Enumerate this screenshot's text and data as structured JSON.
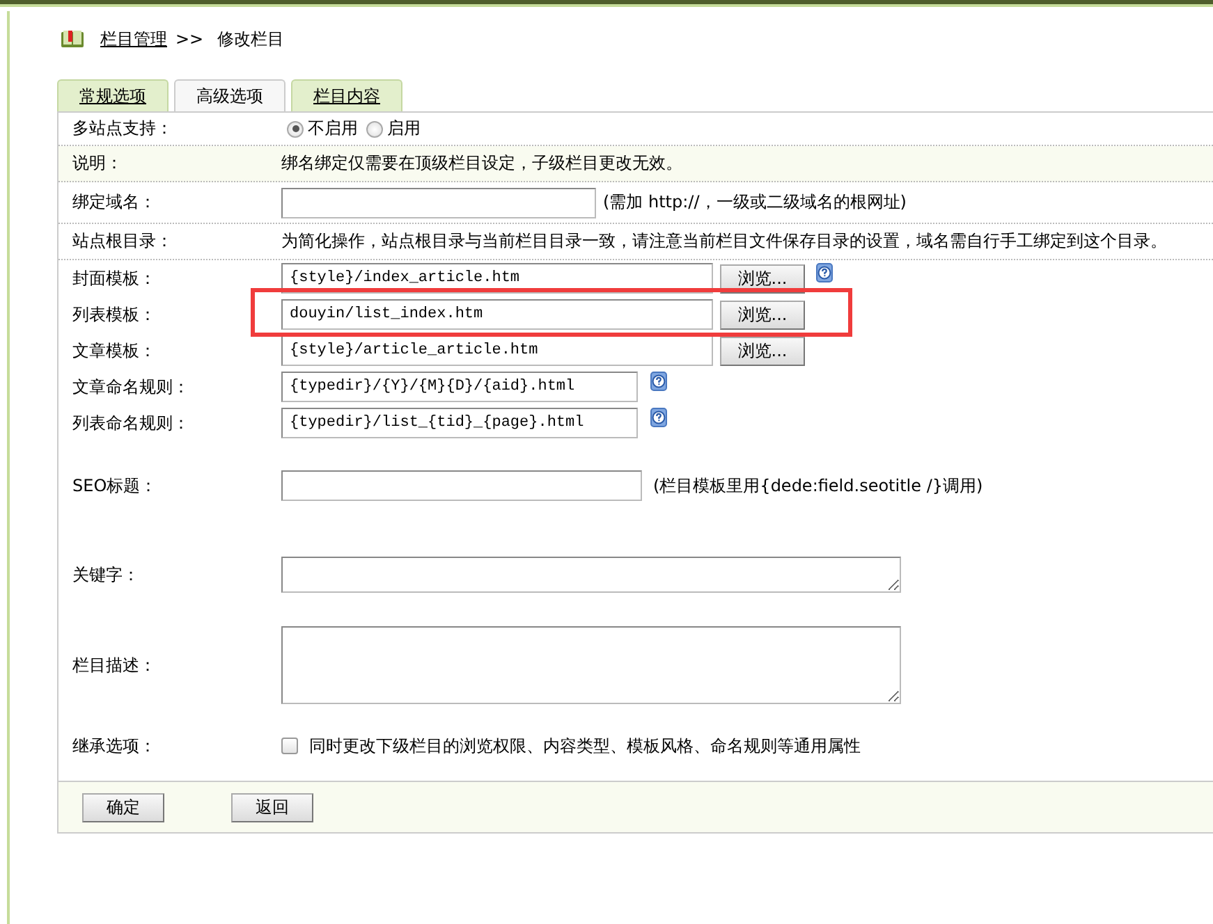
{
  "breadcrumb": {
    "link": "栏目管理",
    "separator": ">>",
    "current": "修改栏目"
  },
  "tabs": [
    {
      "label": "常规选项",
      "selected": false
    },
    {
      "label": "高级选项",
      "selected": true
    },
    {
      "label": "栏目内容",
      "selected": false
    }
  ],
  "rows": [
    {
      "kind": "radio",
      "label": "多站点支持：",
      "options": [
        {
          "label": "不启用",
          "selected": true
        },
        {
          "label": "启用",
          "selected": false
        }
      ]
    },
    {
      "kind": "note",
      "label": "说明：",
      "text": "绑名绑定仅需要在顶级栏目设定，子级栏目更改无效。",
      "shaded": true
    },
    {
      "kind": "text",
      "label": "绑定域名：",
      "hint": "(需加 http://，一级或二级域名的根网址)"
    },
    {
      "kind": "note",
      "label": "站点根目录：",
      "text": "为简化操作，站点根目录与当前栏目目录一致，请注意当前栏目文件保存目录的设置，域名需自行手工绑定到这个目录。",
      "shaded": false
    },
    {
      "kind": "template",
      "label": "封面模板：",
      "value": "{style}/index_article.htm",
      "button": "浏览...",
      "help": true,
      "highlighted": false
    },
    {
      "kind": "template",
      "label": "列表模板：",
      "value": "douyin/list_index.htm",
      "button": "浏览...",
      "help": false,
      "highlighted": true
    },
    {
      "kind": "template",
      "label": "文章模板：",
      "value": "{style}/article_article.htm",
      "button": "浏览...",
      "help": false,
      "highlighted": false
    },
    {
      "kind": "rule",
      "label": "文章命名规则：",
      "value": "{typedir}/{Y}/{M}{D}/{aid}.html",
      "help": true
    },
    {
      "kind": "rule",
      "label": "列表命名规则：",
      "value": "{typedir}/list_{tid}_{page}.html",
      "help": true
    },
    {
      "kind": "seo",
      "label": "SEO标题：",
      "hint": "(栏目模板里用{dede:field.seotitle /}调用)"
    },
    {
      "kind": "short-textarea",
      "label": "关键字："
    },
    {
      "kind": "textarea",
      "label": "栏目描述："
    },
    {
      "kind": "checkbox",
      "label": "继承选项：",
      "checked": false,
      "text": "同时更改下级栏目的浏览权限、内容类型、模板风格、命名规则等通用属性"
    }
  ],
  "buttons": [
    "确定",
    "返回"
  ]
}
